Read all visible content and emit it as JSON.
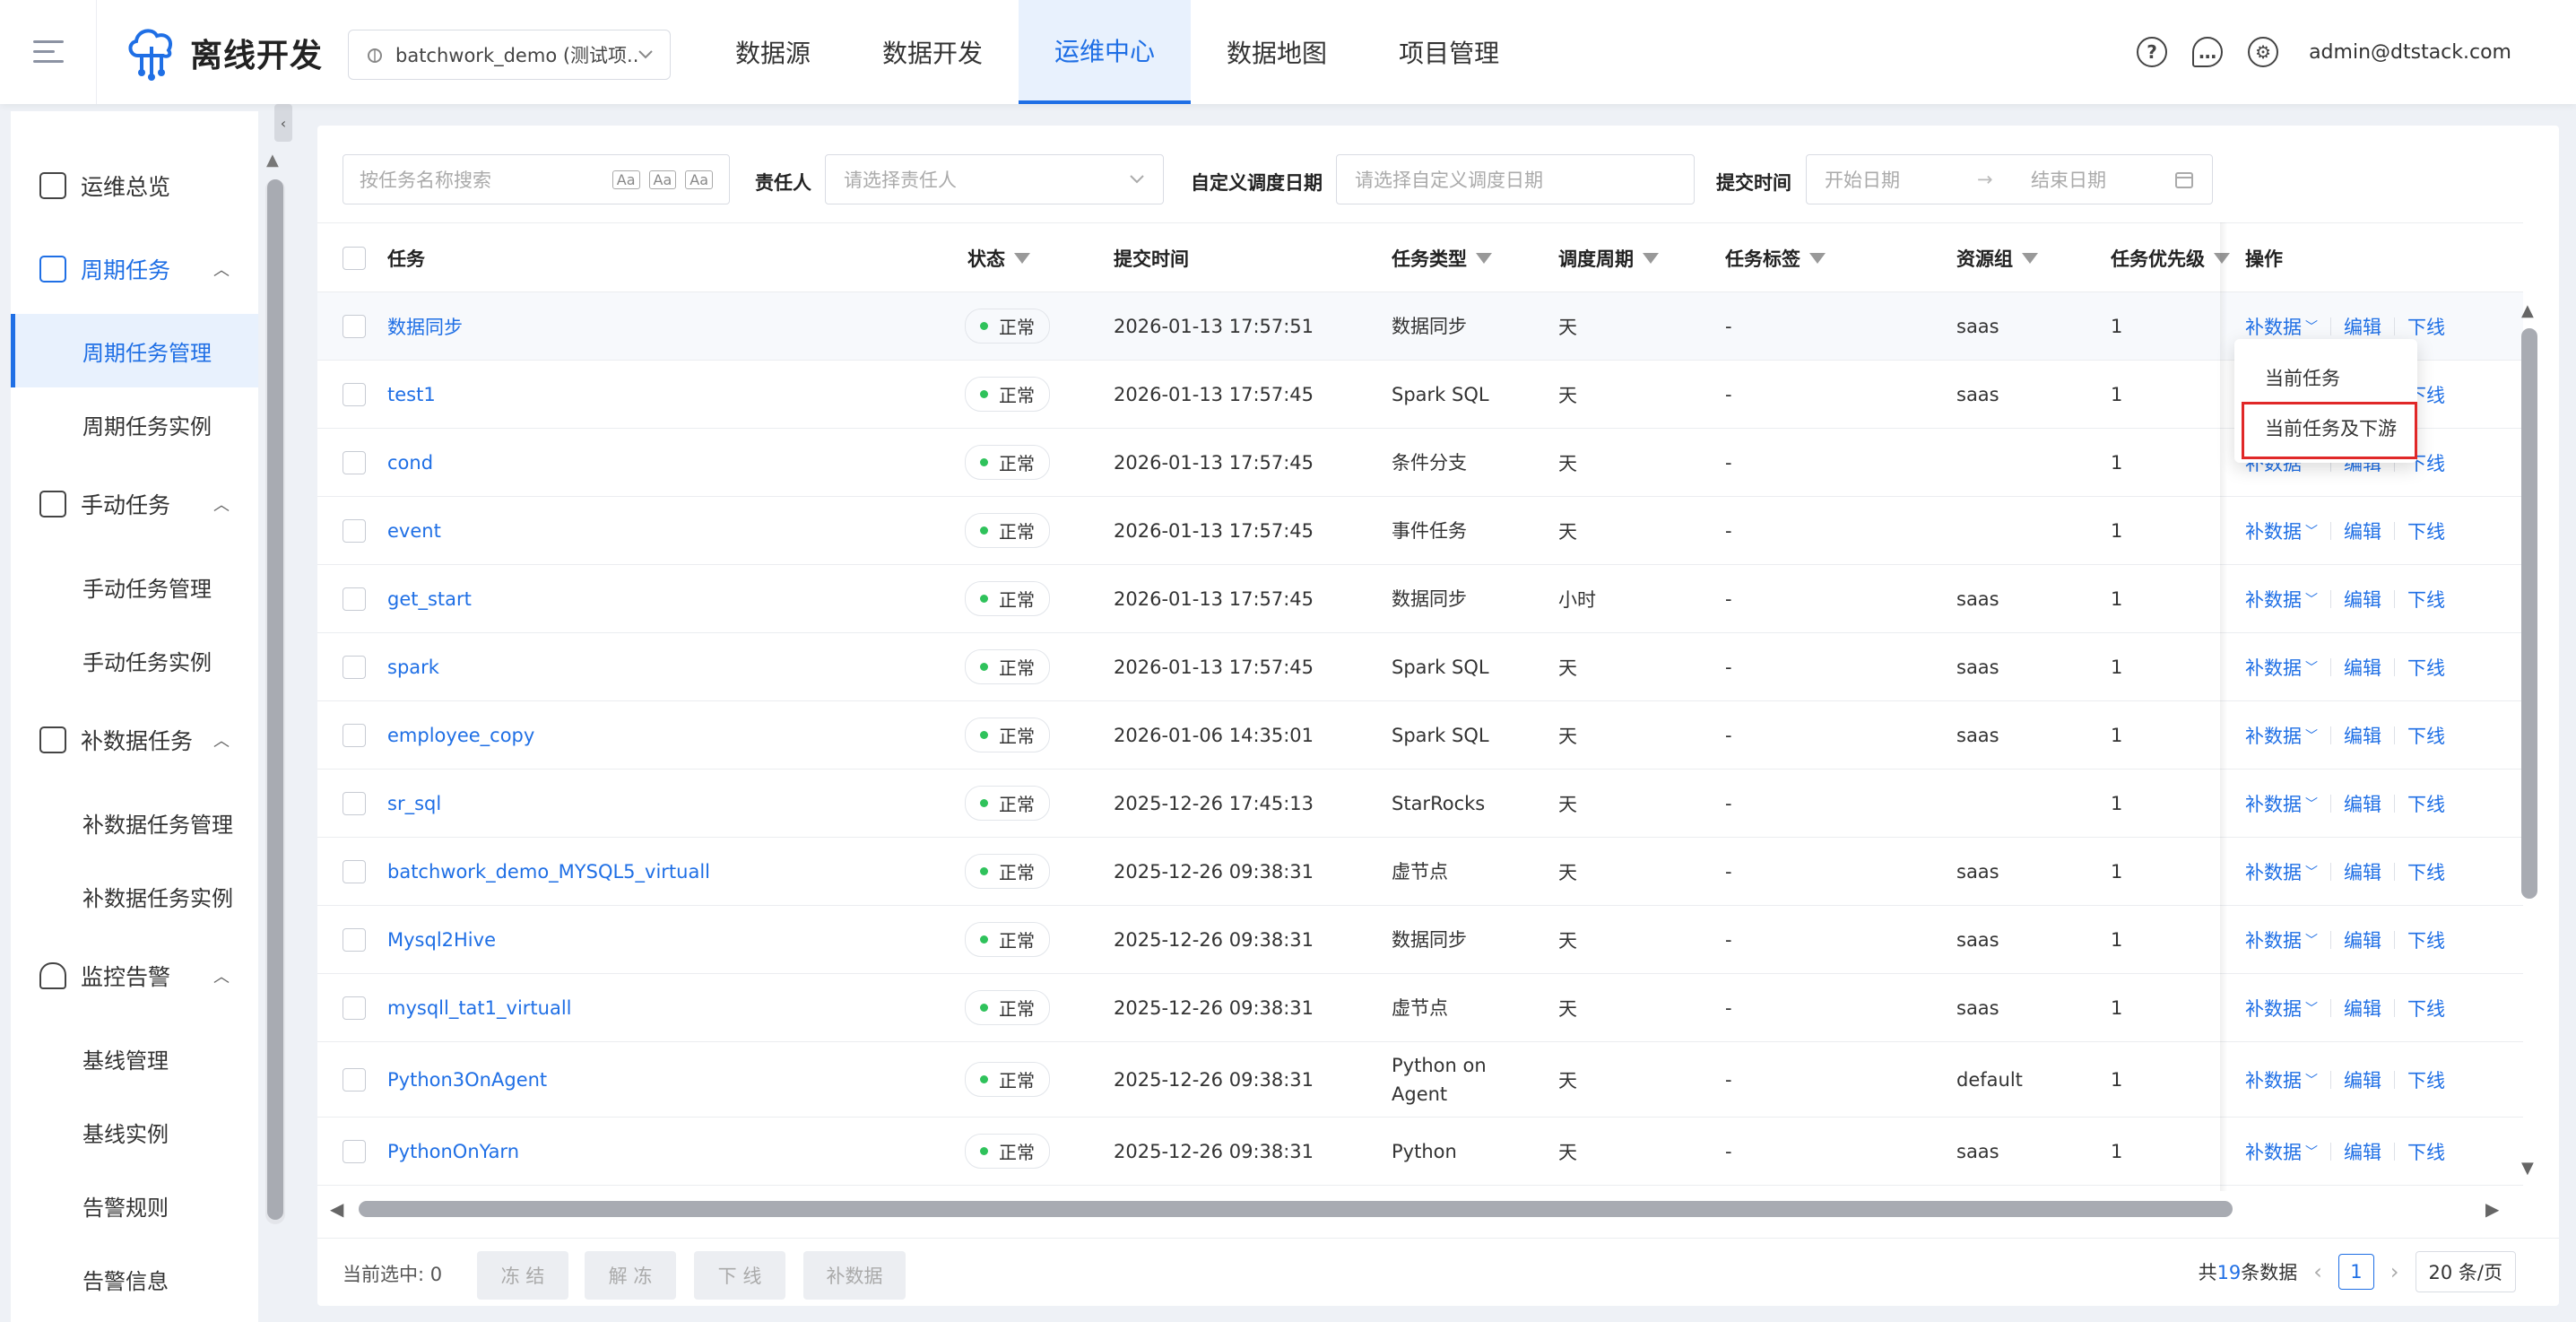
{
  "header": {
    "app_title": "离线开发",
    "project": "batchwork_demo (测试项...",
    "nav": [
      "数据源",
      "数据开发",
      "运维中心",
      "数据地图",
      "项目管理"
    ],
    "active_nav_index": 2,
    "user": "admin@dtstack.com"
  },
  "sidebar": {
    "groups": [
      {
        "label": "运维总览",
        "icon": "dashboard-icon"
      },
      {
        "label": "周期任务",
        "icon": "periodic-task-icon"
      },
      {
        "label": "手动任务",
        "icon": "manual-task-icon"
      },
      {
        "label": "补数据任务",
        "icon": "backfill-task-icon"
      },
      {
        "label": "监控告警",
        "icon": "bell-icon"
      }
    ],
    "items": {
      "periodic_manage": "周期任务管理",
      "periodic_instance": "周期任务实例",
      "manual_manage": "手动任务管理",
      "manual_instance": "手动任务实例",
      "backfill_manage": "补数据任务管理",
      "backfill_instance": "补数据任务实例",
      "baseline_manage": "基线管理",
      "baseline_instance": "基线实例",
      "alert_rules": "告警规则",
      "alert_info": "告警信息"
    }
  },
  "filters": {
    "search_placeholder": "按任务名称搜索",
    "search_toggle_case": "Aa",
    "search_toggle_word": "Aa",
    "search_toggle_regex": "Aa",
    "owner_label": "责任人",
    "owner_placeholder": "请选择责任人",
    "custom_date_label": "自定义调度日期",
    "custom_date_placeholder": "请选择自定义调度日期",
    "submit_time_label": "提交时间",
    "start_placeholder": "开始日期",
    "end_placeholder": "结束日期",
    "range_arrow": "→"
  },
  "table": {
    "headers": {
      "task": "任务",
      "status": "状态",
      "submit_time": "提交时间",
      "type": "任务类型",
      "cycle": "调度周期",
      "tags": "任务标签",
      "resource": "资源组",
      "priority": "任务优先级",
      "ops": "操作"
    },
    "ops": {
      "backfill": "补数据",
      "edit": "编辑",
      "offline": "下线"
    },
    "rows": [
      {
        "name": "数据同步",
        "status": "正常",
        "time": "2026-01-13 17:57:51",
        "type": "数据同步",
        "cycle": "天",
        "tag": "-",
        "resource": "saas",
        "priority": "1"
      },
      {
        "name": "test1",
        "status": "正常",
        "time": "2026-01-13 17:57:45",
        "type": "Spark SQL",
        "cycle": "天",
        "tag": "-",
        "resource": "saas",
        "priority": "1"
      },
      {
        "name": "cond",
        "status": "正常",
        "time": "2026-01-13 17:57:45",
        "type": "条件分支",
        "cycle": "天",
        "tag": "-",
        "resource": "",
        "priority": "1"
      },
      {
        "name": "event",
        "status": "正常",
        "time": "2026-01-13 17:57:45",
        "type": "事件任务",
        "cycle": "天",
        "tag": "-",
        "resource": "",
        "priority": "1"
      },
      {
        "name": "get_start",
        "status": "正常",
        "time": "2026-01-13 17:57:45",
        "type": "数据同步",
        "cycle": "小时",
        "tag": "-",
        "resource": "saas",
        "priority": "1"
      },
      {
        "name": "spark",
        "status": "正常",
        "time": "2026-01-13 17:57:45",
        "type": "Spark SQL",
        "cycle": "天",
        "tag": "-",
        "resource": "saas",
        "priority": "1"
      },
      {
        "name": "employee_copy",
        "status": "正常",
        "time": "2026-01-06 14:35:01",
        "type": "Spark SQL",
        "cycle": "天",
        "tag": "-",
        "resource": "saas",
        "priority": "1"
      },
      {
        "name": "sr_sql",
        "status": "正常",
        "time": "2025-12-26 17:45:13",
        "type": "StarRocks",
        "cycle": "天",
        "tag": "-",
        "resource": "",
        "priority": "1"
      },
      {
        "name": "batchwork_demo_MYSQL5_virtuall",
        "status": "正常",
        "time": "2025-12-26 09:38:31",
        "type": "虚节点",
        "cycle": "天",
        "tag": "-",
        "resource": "saas",
        "priority": "1"
      },
      {
        "name": "Mysql2Hive",
        "status": "正常",
        "time": "2025-12-26 09:38:31",
        "type": "数据同步",
        "cycle": "天",
        "tag": "-",
        "resource": "saas",
        "priority": "1"
      },
      {
        "name": "mysqll_tat1_virtuall",
        "status": "正常",
        "time": "2025-12-26 09:38:31",
        "type": "虚节点",
        "cycle": "天",
        "tag": "-",
        "resource": "saas",
        "priority": "1"
      },
      {
        "name": "Python3OnAgent",
        "status": "正常",
        "time": "2025-12-26 09:38:31",
        "type": "Python on Agent",
        "cycle": "天",
        "tag": "-",
        "resource": "default",
        "priority": "1"
      },
      {
        "name": "PythonOnYarn",
        "status": "正常",
        "time": "2025-12-26 09:38:31",
        "type": "Python",
        "cycle": "天",
        "tag": "-",
        "resource": "saas",
        "priority": "1"
      }
    ]
  },
  "dropdown": {
    "current": "当前任务",
    "current_downstream": "当前任务及下游"
  },
  "footer": {
    "selected_label": "当前选中: 0",
    "freeze": "冻 结",
    "unfreeze": "解 冻",
    "offline": "下 线",
    "backfill": "补数据",
    "total_prefix": "共",
    "total": "19",
    "total_suffix": "条数据",
    "page": "1",
    "page_size": "20 条/页"
  },
  "colors": {
    "accent": "#1f6fe5",
    "status_ok": "#2fc25b",
    "highlight": "#e02828"
  }
}
